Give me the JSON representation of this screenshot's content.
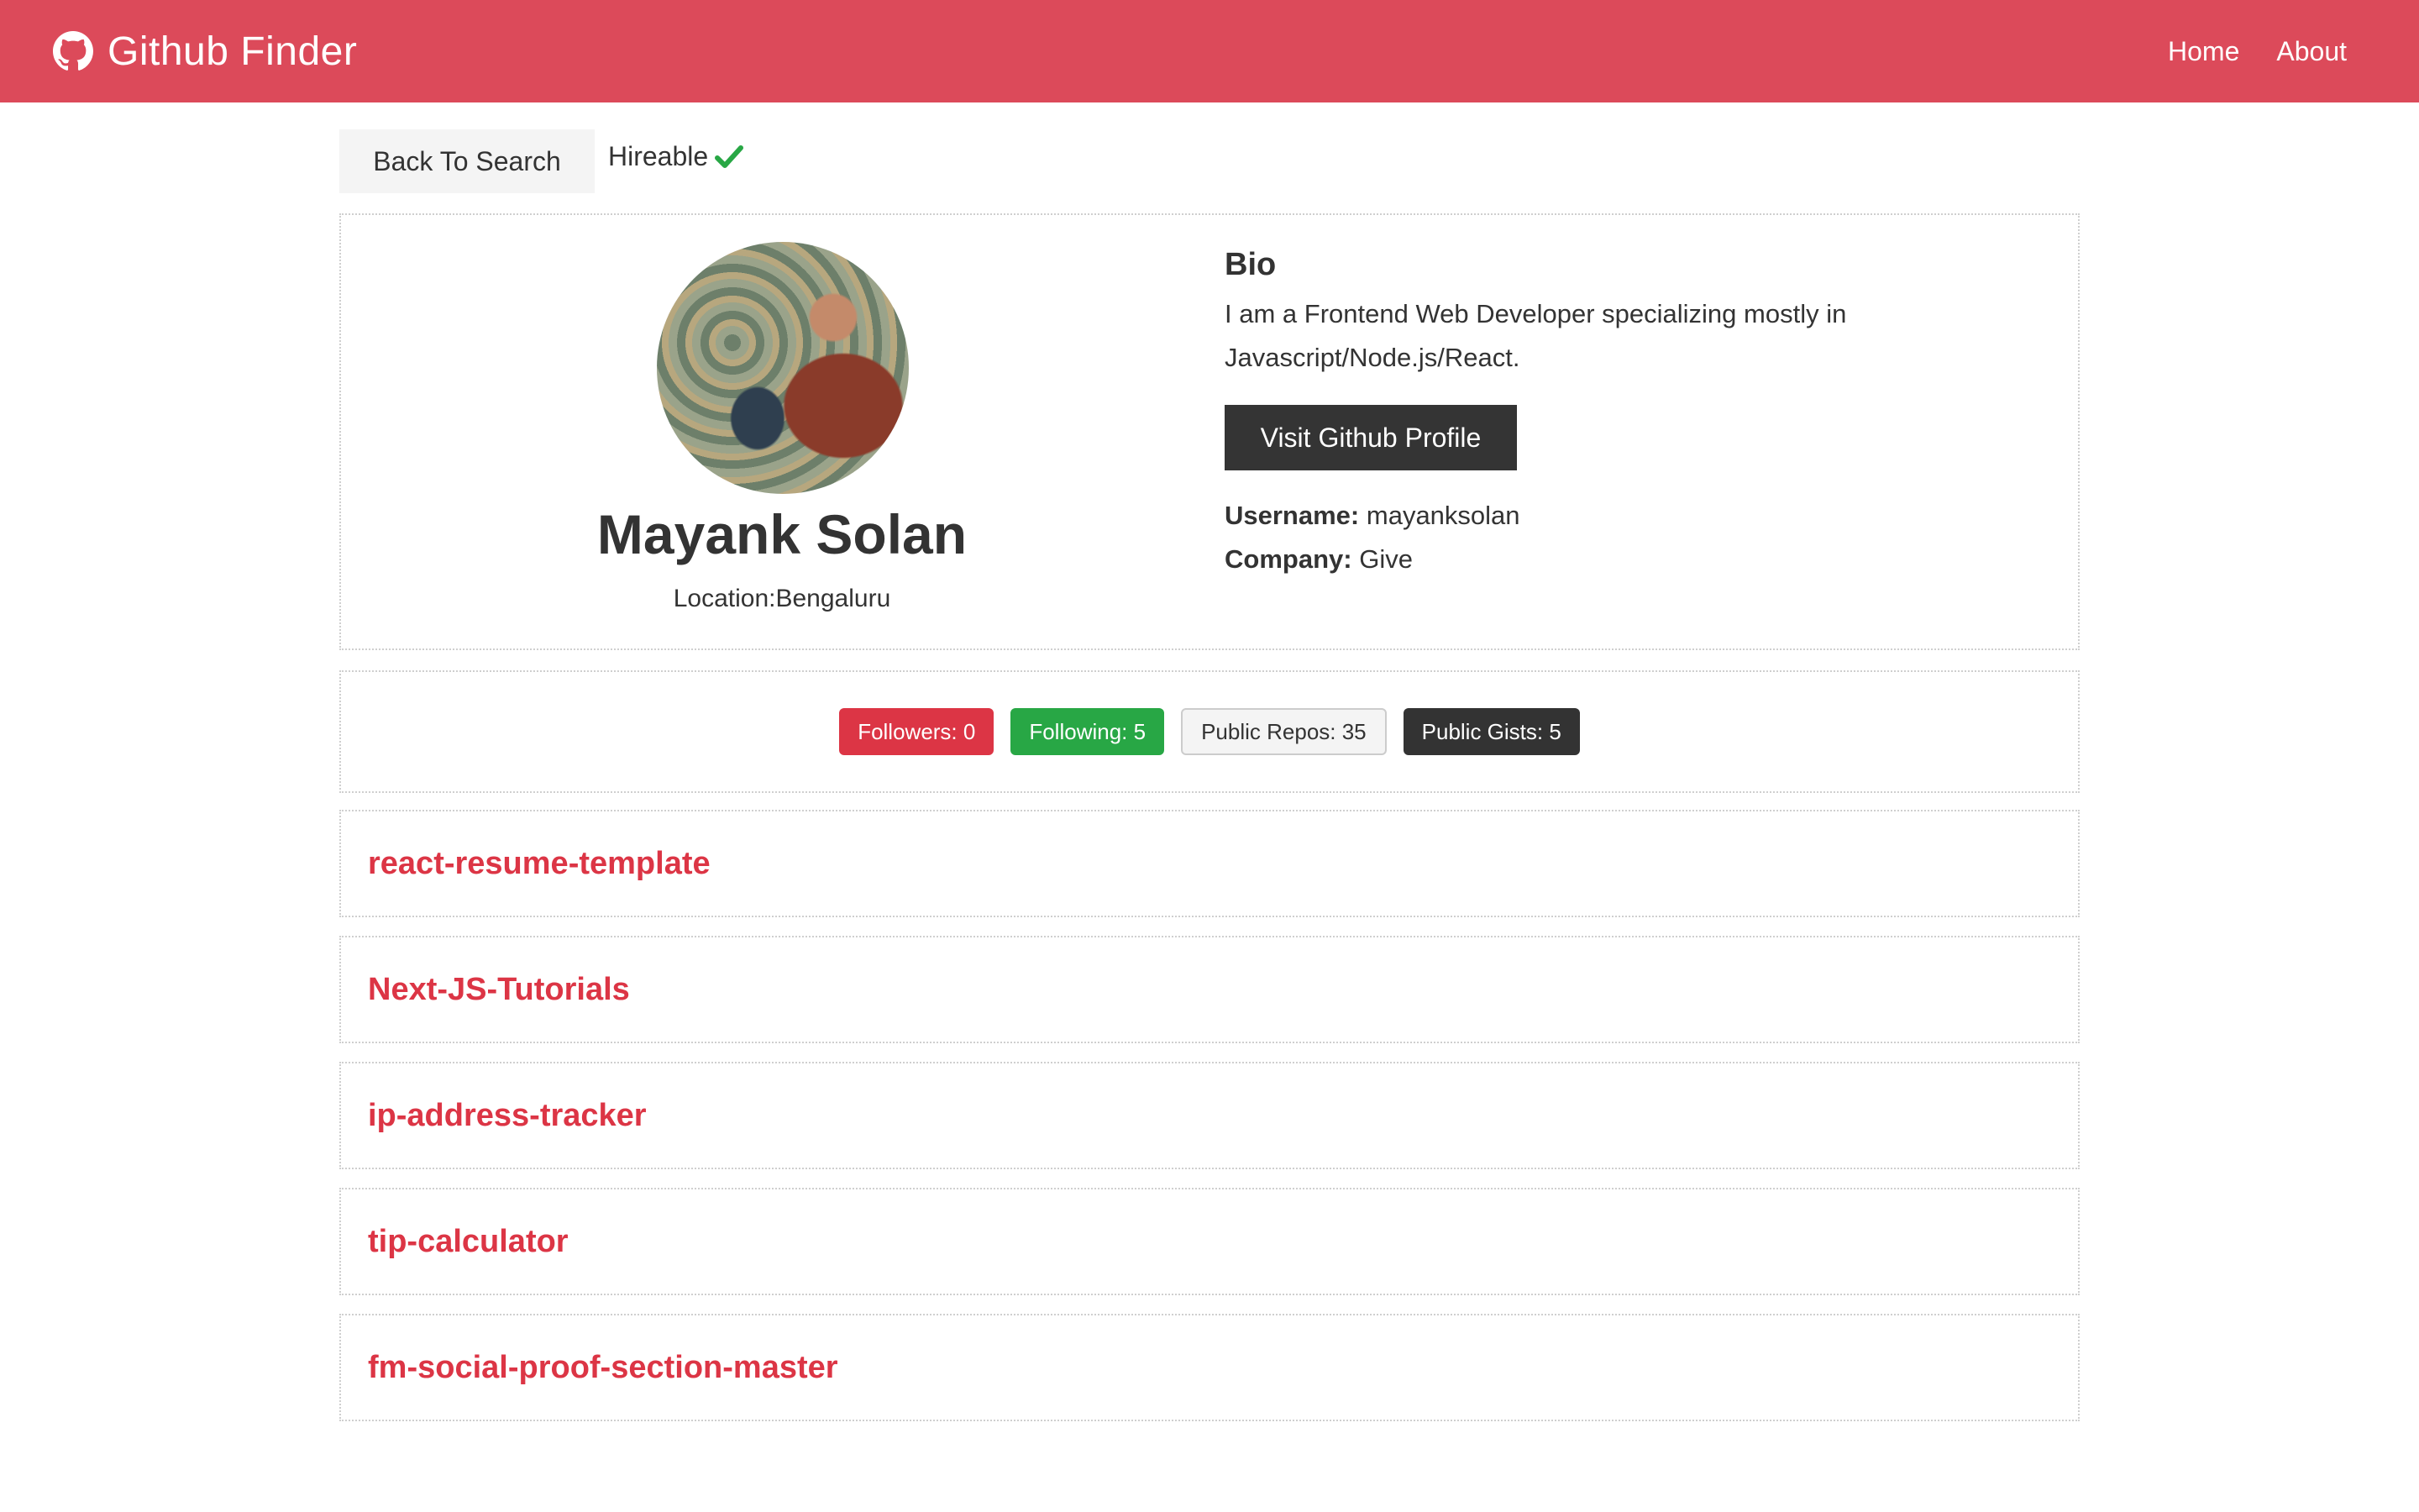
{
  "navbar": {
    "brand_title": "Github Finder",
    "brand_icon": "github-icon",
    "links": [
      {
        "label": "Home"
      },
      {
        "label": "About"
      }
    ],
    "background_color": "#dc4a5a"
  },
  "actions": {
    "back_label": "Back To Search",
    "hireable_label": "Hireable",
    "hireable_icon": "check-icon"
  },
  "profile": {
    "name": "Mayank Solan",
    "location": "Location:Bengaluru",
    "bio_heading": "Bio",
    "bio": "I am a Frontend Web Developer specializing mostly in Javascript/Node.js/React.",
    "visit_label": "Visit Github Profile",
    "username_label": "Username:",
    "username": "mayanksolan",
    "company_label": "Company:",
    "company": "Give"
  },
  "stats": {
    "followers": "Followers: 0",
    "following": "Following: 5",
    "public_repos": "Public Repos: 35",
    "public_gists": "Public Gists: 5"
  },
  "repos": [
    {
      "name": "react-resume-template"
    },
    {
      "name": "Next-JS-Tutorials"
    },
    {
      "name": "ip-address-tracker"
    },
    {
      "name": "tip-calculator"
    },
    {
      "name": "fm-social-proof-section-master"
    }
  ],
  "colors": {
    "accent": "#dc3545",
    "success": "#28a745",
    "dark": "#333333"
  }
}
